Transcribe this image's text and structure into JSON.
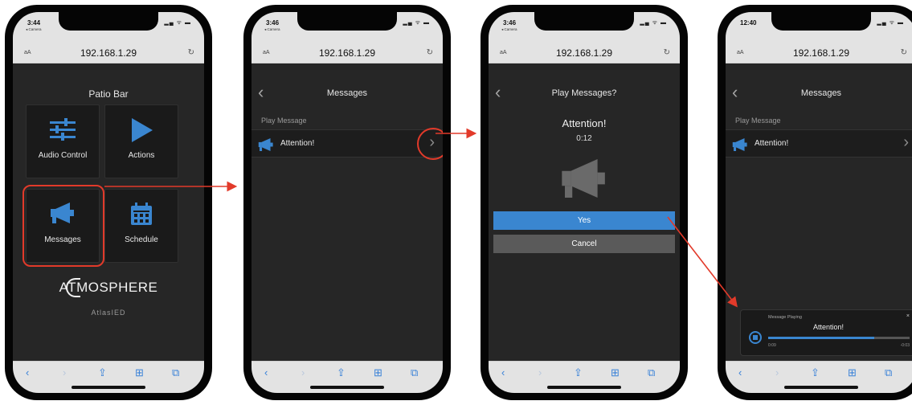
{
  "colors": {
    "accent_blue": "#3a86d0",
    "annotation_red": "#e23a2a",
    "screen_bg": "#262626",
    "tile_bg": "#1a1a1a"
  },
  "browser": {
    "url": "192.168.1.29",
    "text_size_label": "aA",
    "reload_icon": "reload-icon",
    "back_icon": "chevron-left-icon",
    "forward_icon": "chevron-right-icon",
    "share_icon": "share-icon",
    "bookmarks_icon": "book-icon",
    "tabs_icon": "tabs-icon"
  },
  "phone1": {
    "status": {
      "time": "3:44",
      "camera": "◂ Camera"
    },
    "title": "Patio Bar",
    "tiles": [
      {
        "label": "Audio Control",
        "icon": "sliders-icon"
      },
      {
        "label": "Actions",
        "icon": "play-icon"
      },
      {
        "label": "Messages",
        "icon": "megaphone-icon"
      },
      {
        "label": "Schedule",
        "icon": "calendar-icon"
      }
    ],
    "logo_text": "ATMOSPHERE",
    "brand_text": "AtlasIED"
  },
  "phone2": {
    "status": {
      "time": "3:46",
      "camera": "◂ Camera"
    },
    "title": "Messages",
    "section": "Play Message",
    "row": {
      "label": "Attention!",
      "icon": "megaphone-icon"
    }
  },
  "phone3": {
    "status": {
      "time": "3:46",
      "camera": "◂ Camera"
    },
    "title": "Play Messages?",
    "message": "Attention!",
    "duration": "0:12",
    "yes_label": "Yes",
    "cancel_label": "Cancel"
  },
  "phone4": {
    "status": {
      "time": "12:40"
    },
    "title": "Messages",
    "section": "Play Message",
    "row": {
      "label": "Attention!",
      "icon": "megaphone-icon"
    },
    "player": {
      "title": "Message Playing",
      "message": "Attention!",
      "elapsed": "0:09",
      "remaining": "-0:03",
      "progress_fraction": 0.75,
      "close_label": "×"
    }
  }
}
